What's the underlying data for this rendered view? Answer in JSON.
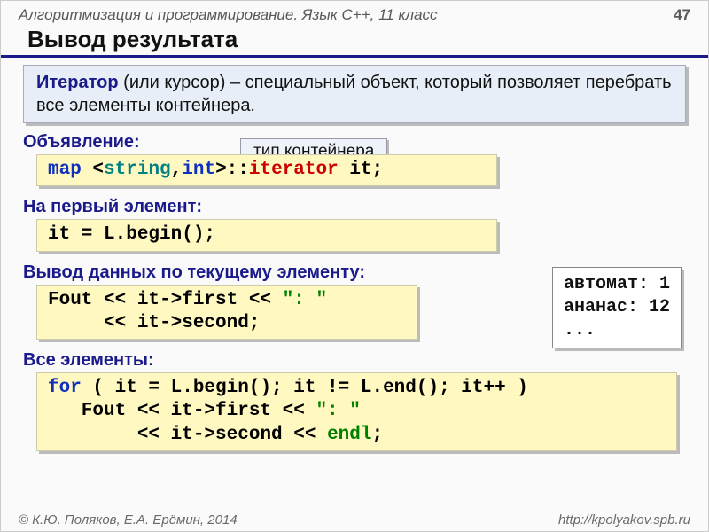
{
  "header": {
    "subject": "Алгоритмизация и программирование. Язык С++, 11 класс",
    "page": "47"
  },
  "title": "Вывод результата",
  "definition": {
    "term": "Итератор",
    "rest": " (или курсор) – специальный объект, который позволяет перебрать все элементы контейнера."
  },
  "callout": "тип контейнера",
  "sections": {
    "decl_label": "Объявление:",
    "first_label": "На первый элемент:",
    "out_label": "Вывод данных по текущему элементу:",
    "all_label": "Все элементы:"
  },
  "code": {
    "decl": {
      "map": "map",
      "lt": " <",
      "string": "string",
      "comma": ",",
      "int": "int",
      "gt": ">::",
      "iterator": "iterator",
      "tail": " it;"
    },
    "first": "it = L.begin();",
    "out_line1_a": "Fout << it->first << ",
    "out_line1_b": "\": \"",
    "out_line2": "     << it->second;",
    "all_line1_a": "for",
    "all_line1_b": " ( it = L.begin(); it != L.end(); it++ )",
    "all_line2_a": "   Fout << it->first << ",
    "all_line2_b": "\": \"",
    "all_line3_a": "        << it->second << ",
    "all_line3_b": "endl",
    "all_line3_c": ";"
  },
  "output": "автомат: 1\nананас: 12\n...",
  "footer": {
    "left": "© К.Ю. Поляков, Е.А. Ерёмин, 2014",
    "right": "http://kpolyakov.spb.ru"
  }
}
